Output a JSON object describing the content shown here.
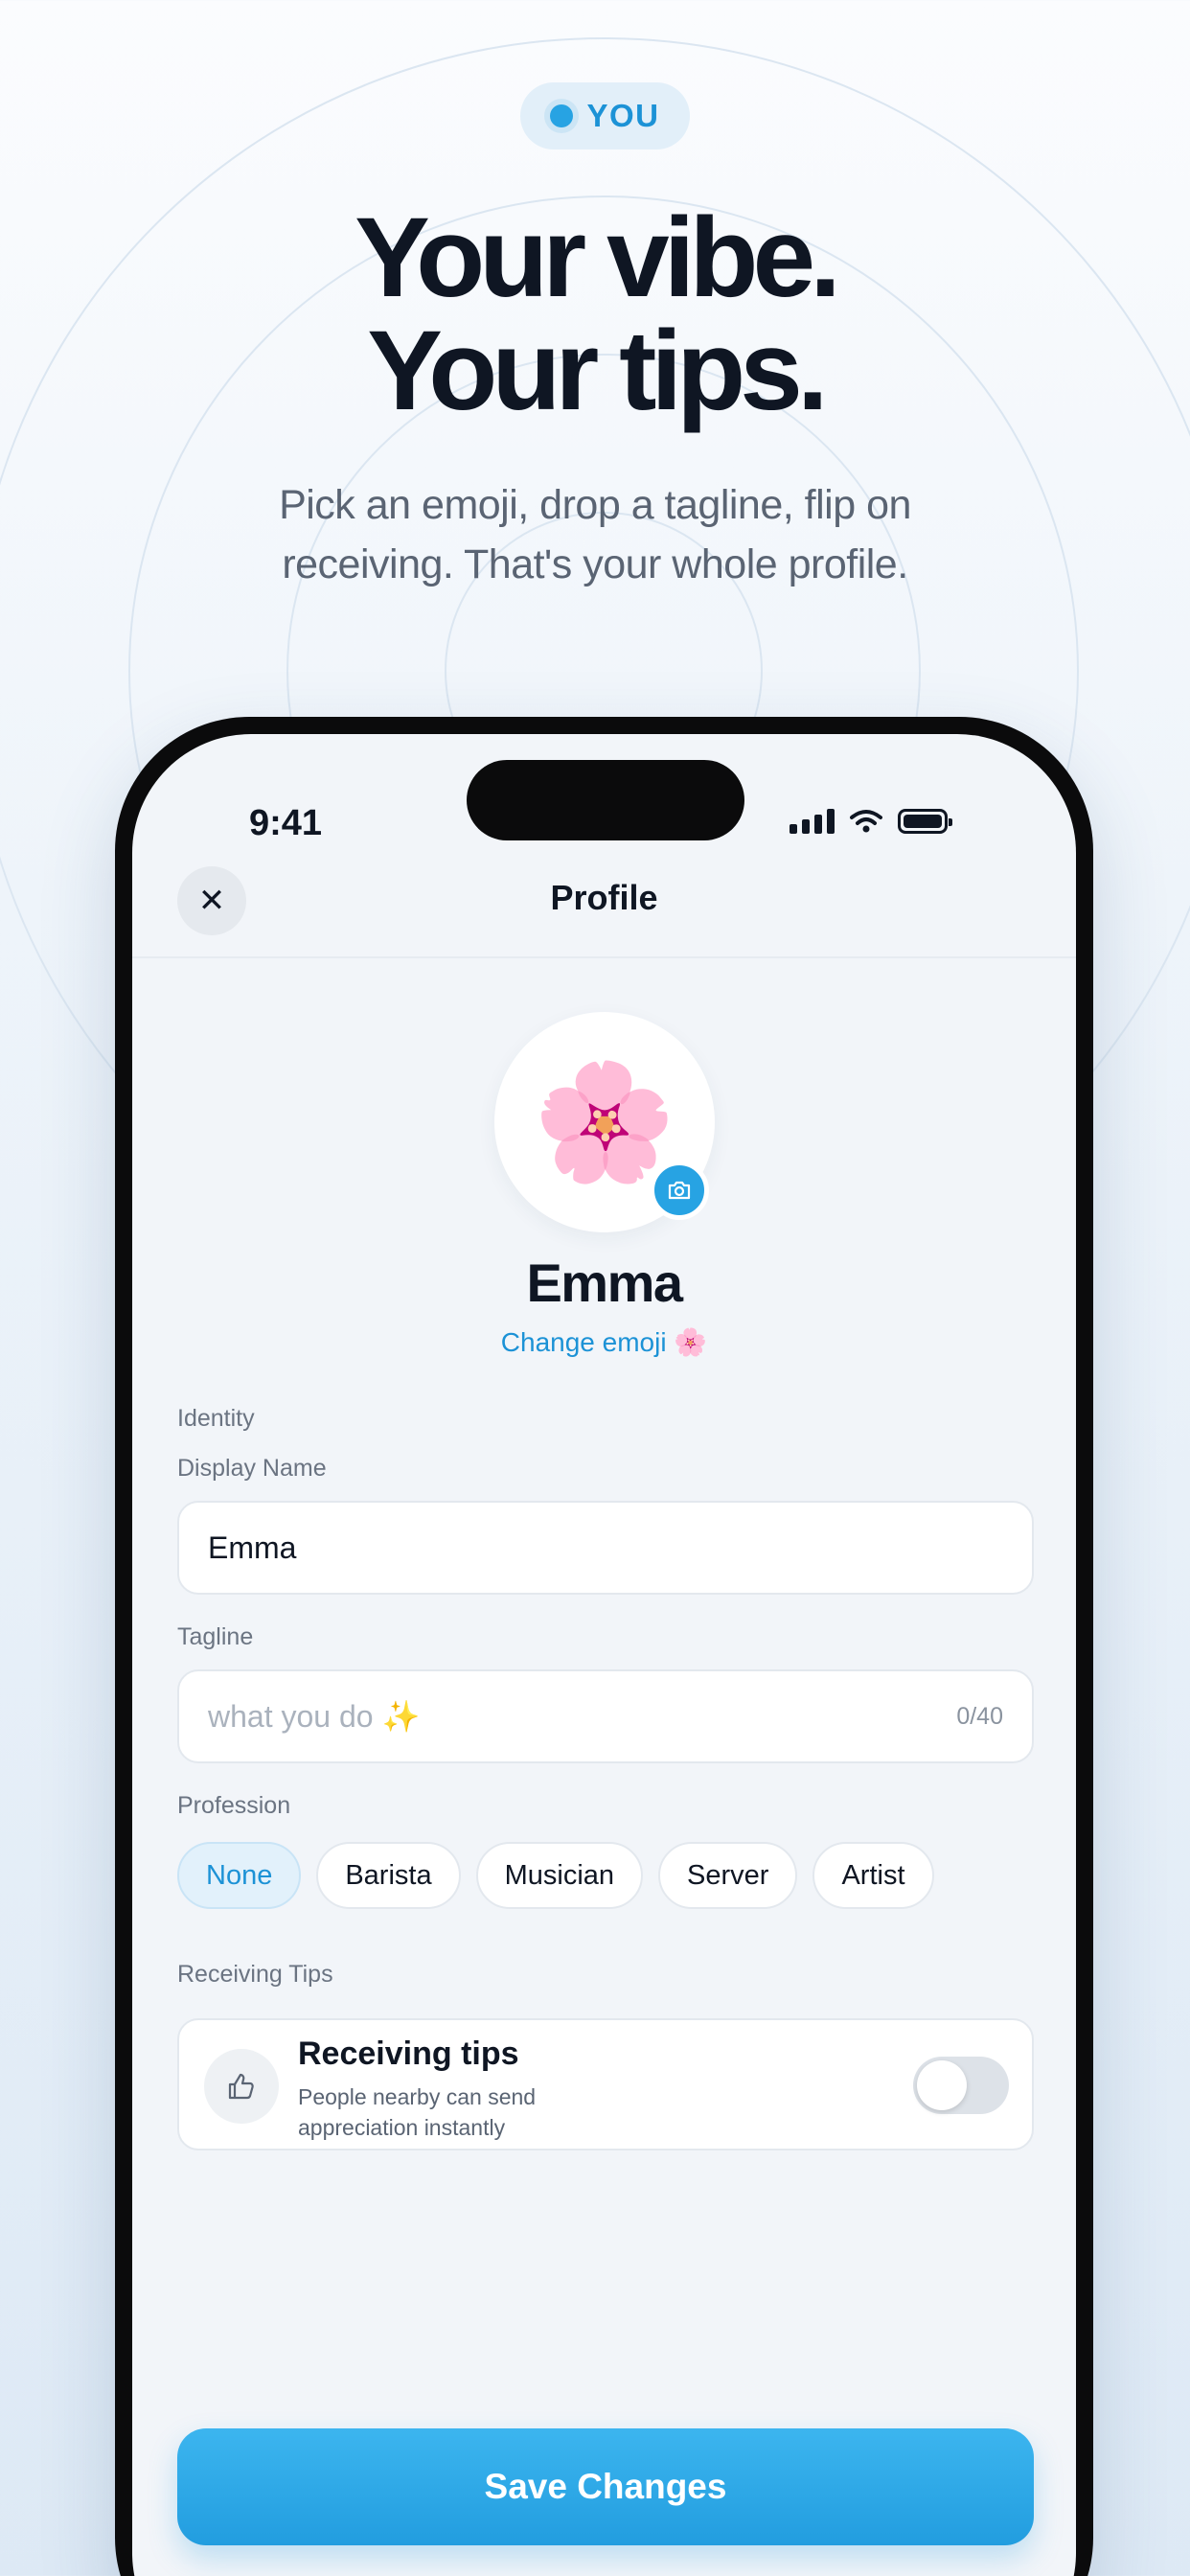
{
  "badge": {
    "label": "YOU"
  },
  "hero": {
    "headline_line1": "Your vibe.",
    "headline_line2": "Your tips.",
    "subtitle_line1": "Pick an emoji, drop a tagline, flip on",
    "subtitle_line2": "receiving. That's your whole profile."
  },
  "status_bar": {
    "time": "9:41"
  },
  "nav": {
    "title": "Profile",
    "close_label": "✕"
  },
  "profile": {
    "emoji": "🌸",
    "name": "Emma",
    "change_emoji_label": "Change emoji 🌸"
  },
  "form": {
    "identity_section": "Identity",
    "display_name_label": "Display Name",
    "display_name_value": "Emma",
    "tagline_label": "Tagline",
    "tagline_placeholder": "what you do ✨",
    "tagline_counter": "0/40",
    "profession_label": "Profession",
    "professions": [
      "None",
      "Barista",
      "Musician",
      "Server",
      "Artist"
    ],
    "profession_selected": "None"
  },
  "tips": {
    "section_label": "Receiving Tips",
    "title": "Receiving tips",
    "description": "People nearby can send appreciation instantly",
    "enabled": false
  },
  "actions": {
    "save_label": "Save Changes"
  },
  "colors": {
    "accent": "#27a3e3",
    "text_primary": "#0f1623",
    "text_secondary": "#5a6473"
  },
  "icons": [
    "close-icon",
    "camera-icon",
    "thumbs-up-icon",
    "signal-icon",
    "wifi-icon",
    "battery-icon"
  ]
}
